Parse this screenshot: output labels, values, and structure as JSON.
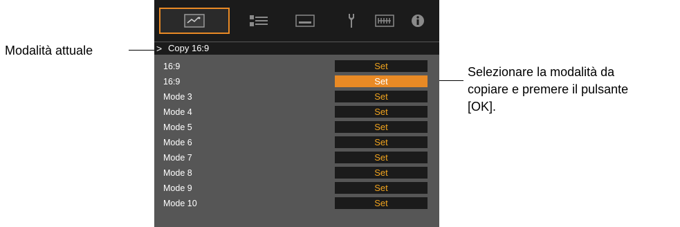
{
  "callouts": {
    "left": "Modalità attuale",
    "right_lines": [
      "Selezionare la modalità da",
      "copiare e premere il pulsante",
      "[OK]."
    ]
  },
  "icon_tabs": [
    {
      "name": "picture-adjust-icon",
      "selected": true
    },
    {
      "name": "input-signal-icon",
      "selected": false
    },
    {
      "name": "installation-icon",
      "selected": false
    },
    {
      "name": "function-icon",
      "selected": false
    },
    {
      "name": "display-setup-icon",
      "selected": false
    },
    {
      "name": "information-icon",
      "selected": false
    }
  ],
  "header": {
    "caret": ">",
    "title": "Copy 16:9"
  },
  "rows": [
    {
      "label": "16:9",
      "button": "Set",
      "active": false
    },
    {
      "label": "16:9",
      "button": "Set",
      "active": true
    },
    {
      "label": "Mode 3",
      "button": "Set",
      "active": false
    },
    {
      "label": "Mode 4",
      "button": "Set",
      "active": false
    },
    {
      "label": "Mode 5",
      "button": "Set",
      "active": false
    },
    {
      "label": "Mode 6",
      "button": "Set",
      "active": false
    },
    {
      "label": "Mode 7",
      "button": "Set",
      "active": false
    },
    {
      "label": "Mode 8",
      "button": "Set",
      "active": false
    },
    {
      "label": "Mode 9",
      "button": "Set",
      "active": false
    },
    {
      "label": "Mode 10",
      "button": "Set",
      "active": false
    }
  ],
  "colors": {
    "accent": "#e98a25",
    "button_text": "#f0a31e",
    "panel": "#565656",
    "bar": "#1b1b1b"
  }
}
